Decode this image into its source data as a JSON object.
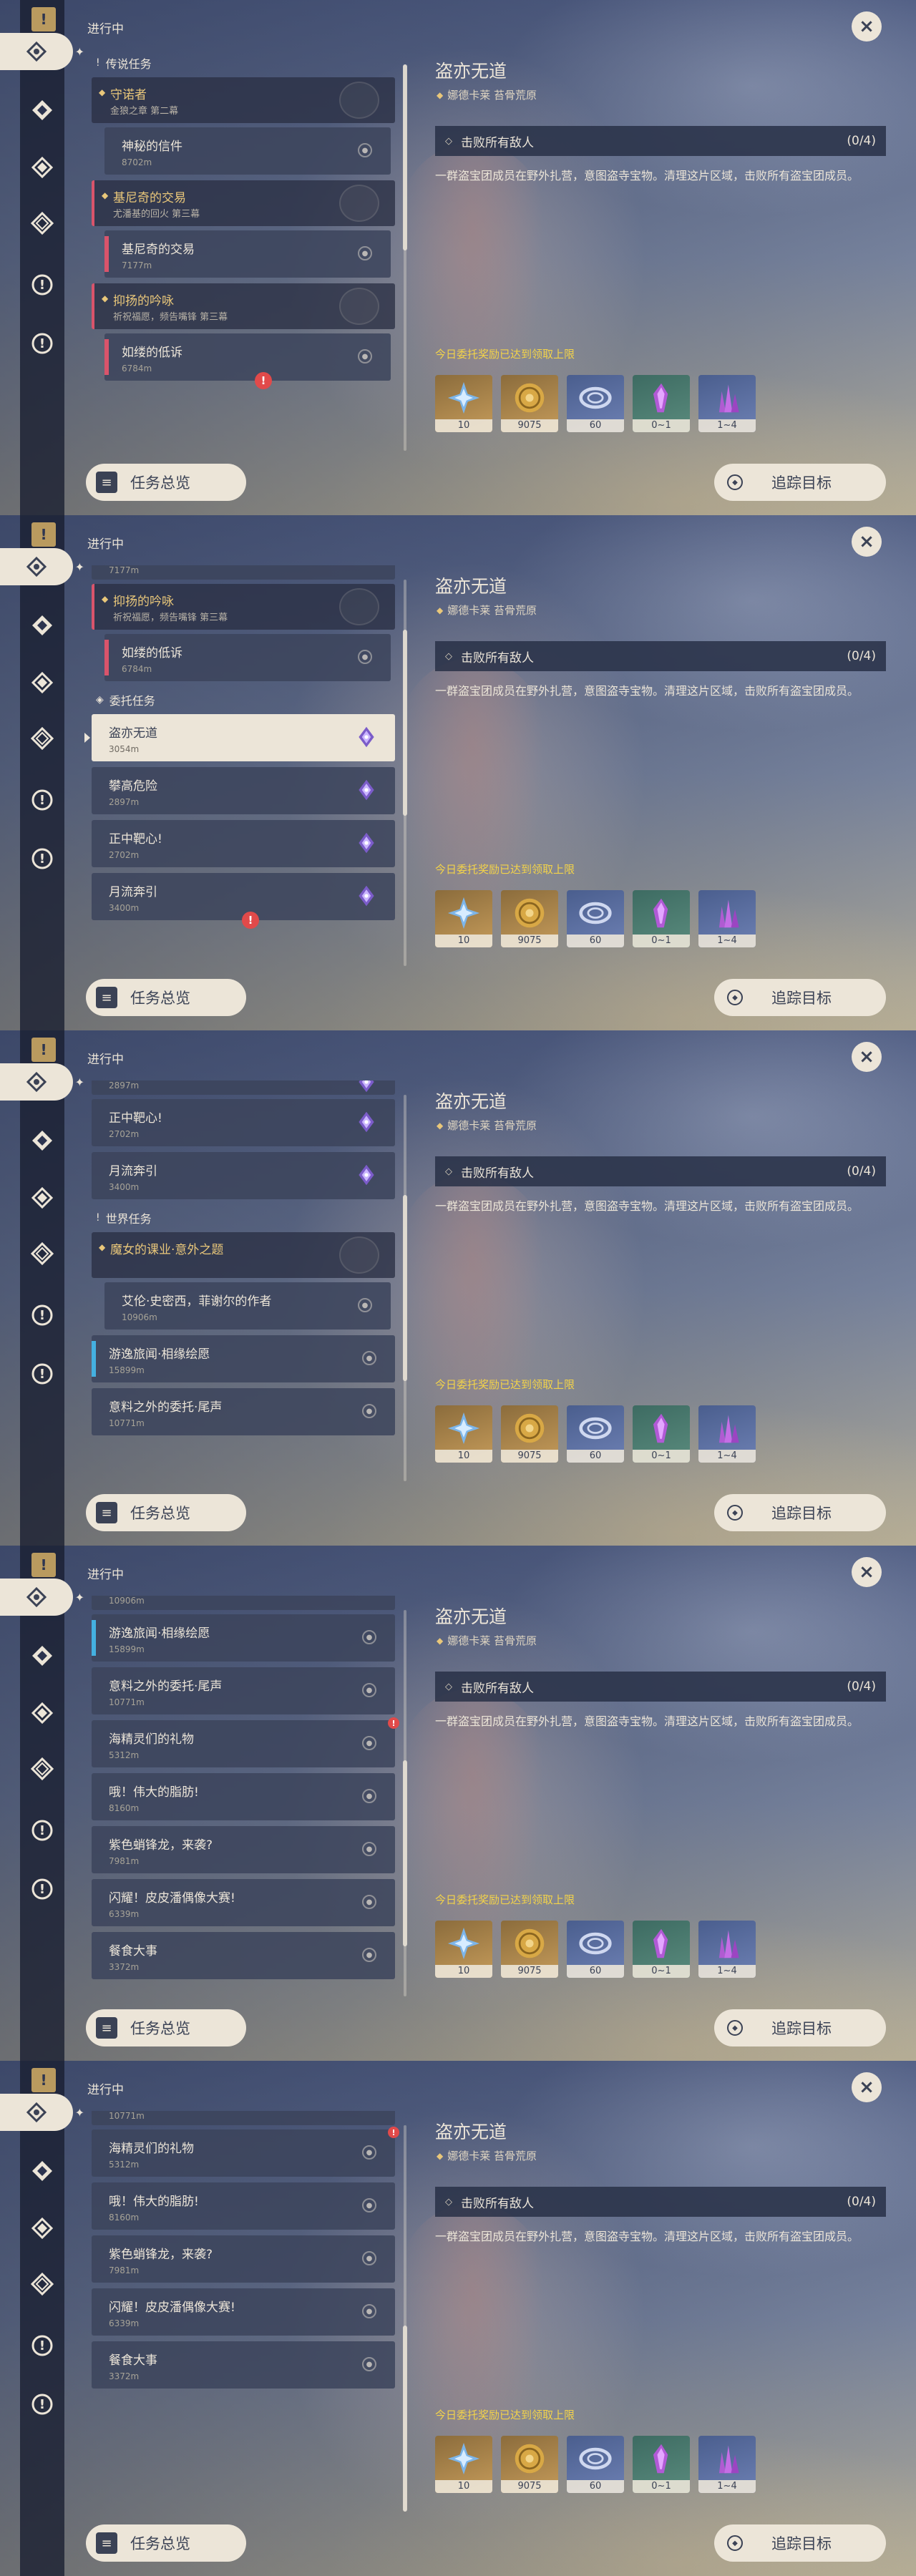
{
  "common": {
    "section_title": "进行中",
    "overview_label": "任务总览",
    "track_label": "追踪目标",
    "detail": {
      "title": "盗亦无道",
      "location": "娜德卡莱 苔骨荒原",
      "objective": "击败所有敌人",
      "progress": "(0/4)",
      "description": "一群盗宝团成员在野外扎营，意图盗寺宝物。清理这片区域，击败所有盗宝团成员。",
      "reward_note": "今日委托奖励已达到领取上限",
      "rewards": [
        {
          "qty": "10",
          "kind": "gold",
          "icon": "star-diamond-icon"
        },
        {
          "qty": "9075",
          "kind": "gold",
          "icon": "mora-coin-icon"
        },
        {
          "qty": "60",
          "kind": "blue",
          "icon": "swirl-ring-icon"
        },
        {
          "qty": "0~1",
          "kind": "green",
          "icon": "purple-crystal-icon"
        },
        {
          "qty": "1~4",
          "kind": "blue",
          "icon": "crystal-cluster-icon"
        }
      ]
    }
  },
  "frames": [
    {
      "groups": [
        {
          "type": "head",
          "label": "传说任务",
          "icon": "!"
        },
        {
          "type": "chapter",
          "title": "守诺者",
          "sub": "金狼之章 第二幕",
          "red": false
        },
        {
          "type": "sub",
          "title": "神秘的信件",
          "dist": "8702m",
          "bar": "none"
        },
        {
          "type": "chapter",
          "title": "基尼奇的交易",
          "sub": "尤潘基的回火 第三幕",
          "red": true
        },
        {
          "type": "sub",
          "title": "基尼奇的交易",
          "dist": "7177m",
          "bar": "red"
        },
        {
          "type": "chapter",
          "title": "抑扬的吟咏",
          "sub": "祈祝福愿，频告嘴锋 第三幕",
          "red": true
        },
        {
          "type": "sub",
          "title": "如缕的低诉",
          "dist": "6784m",
          "bar": "red",
          "alert": true
        }
      ]
    },
    {
      "groups": [
        {
          "type": "stub",
          "dist": "7177m"
        },
        {
          "type": "chapter",
          "title": "抑扬的吟咏",
          "sub": "祈祝福愿，频告嘴锋 第三幕",
          "red": true
        },
        {
          "type": "sub",
          "title": "如缕的低诉",
          "dist": "6784m",
          "bar": "red"
        },
        {
          "type": "head",
          "label": "委托任务",
          "icon": "◈"
        },
        {
          "type": "plain",
          "title": "盗亦无道",
          "dist": "3054m",
          "gem": true,
          "selected": true
        },
        {
          "type": "plain",
          "title": "攀高危险",
          "dist": "2897m",
          "gem": true
        },
        {
          "type": "plain",
          "title": "正中靶心!",
          "dist": "2702m",
          "gem": true
        },
        {
          "type": "plain",
          "title": "月流奔引",
          "dist": "3400m",
          "gem": true,
          "alert": true
        }
      ]
    },
    {
      "groups": [
        {
          "type": "stub",
          "dist": "2897m",
          "gem": true
        },
        {
          "type": "plain",
          "title": "正中靶心!",
          "dist": "2702m",
          "gem": true
        },
        {
          "type": "plain",
          "title": "月流奔引",
          "dist": "3400m",
          "gem": true
        },
        {
          "type": "head",
          "label": "世界任务",
          "icon": "!"
        },
        {
          "type": "chapter",
          "title": "魔女的课业·意外之题",
          "sub": "",
          "red": false
        },
        {
          "type": "sub",
          "title": "艾伦·史密西，菲谢尔的作者",
          "dist": "10906m",
          "bar": "none"
        },
        {
          "type": "plain",
          "title": "游逸旅闻·相缘绘愿",
          "dist": "15899m",
          "bar": "blue"
        },
        {
          "type": "plain",
          "title": "意料之外的委托·尾声",
          "dist": "10771m"
        }
      ]
    },
    {
      "groups": [
        {
          "type": "stub",
          "dist": "10906m"
        },
        {
          "type": "plain",
          "title": "游逸旅闻·相缘绘愿",
          "dist": "15899m",
          "bar": "blue"
        },
        {
          "type": "plain",
          "title": "意料之外的委托·尾声",
          "dist": "10771m"
        },
        {
          "type": "plain",
          "title": "海精灵们的礼物",
          "dist": "5312m",
          "alert_small": true
        },
        {
          "type": "plain",
          "title": "哦！伟大的脂肪!",
          "dist": "8160m"
        },
        {
          "type": "plain",
          "title": "紫色蛸锋龙，来袭?",
          "dist": "7981m"
        },
        {
          "type": "plain",
          "title": "闪耀！皮皮潘偶像大赛!",
          "dist": "6339m"
        },
        {
          "type": "plain",
          "title": "餐食大事",
          "dist": "3372m"
        }
      ]
    },
    {
      "groups": [
        {
          "type": "stub",
          "dist": "10771m"
        },
        {
          "type": "plain",
          "title": "海精灵们的礼物",
          "dist": "5312m",
          "alert_small": true
        },
        {
          "type": "plain",
          "title": "哦！伟大的脂肪!",
          "dist": "8160m"
        },
        {
          "type": "plain",
          "title": "紫色蛸锋龙，来袭?",
          "dist": "7981m"
        },
        {
          "type": "plain",
          "title": "闪耀！皮皮潘偶像大赛!",
          "dist": "6339m"
        },
        {
          "type": "plain",
          "title": "餐食大事",
          "dist": "3372m"
        }
      ]
    }
  ],
  "rail_icons": [
    "quest-book-icon",
    "commission-icon",
    "diamond-compass-icon",
    "world-quest-icon",
    "star-quest-icon",
    "exclamation-icon"
  ],
  "colors": {
    "accent_gold": "#e9c77a",
    "legend_red": "#d9546b",
    "cream": "#ece5d8",
    "note_yellow": "#f3d349"
  }
}
